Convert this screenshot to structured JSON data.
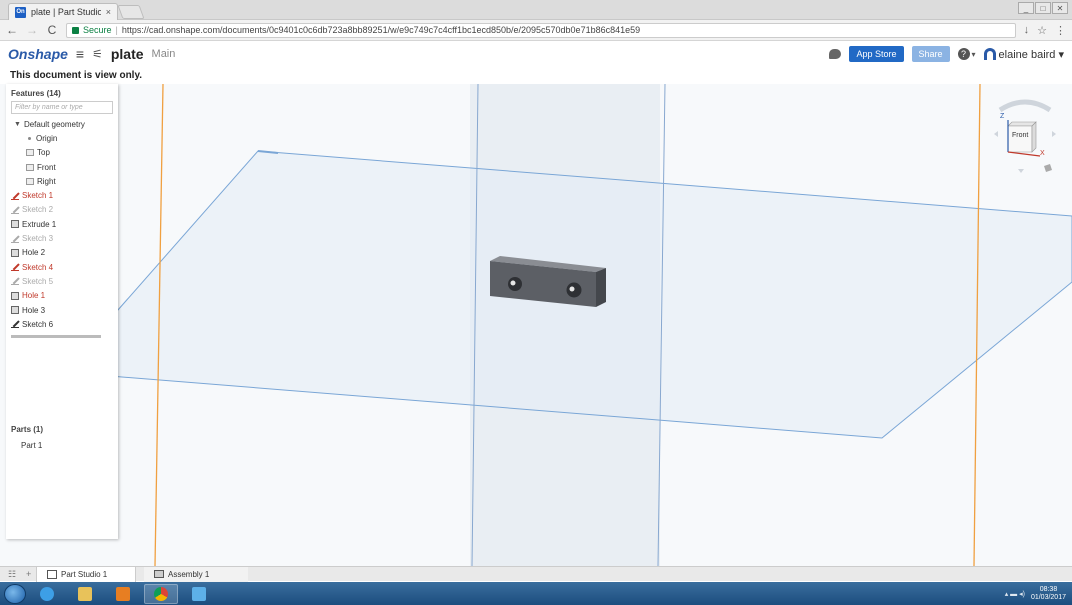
{
  "browser": {
    "tab_title": "plate | Part Studio 1",
    "tab_close": "×",
    "favicon_text": "On",
    "secure_label": "Secure",
    "url": "https://cad.onshape.com/documents/0c9401c0c6db723a8bb89251/w/e9c749c7c4cff1bc1ecd850b/e/2095c570db0e71b86c841e59",
    "back_icon": "←",
    "forward_icon": "→",
    "reload_icon": "C",
    "win_min": "_",
    "win_max": "□",
    "win_close": "✕",
    "ext_icon": "↓",
    "star_icon": "☆",
    "menu_icon": "⋮"
  },
  "app": {
    "logo": "Onshape",
    "menu_icon": "≡",
    "versions_icon": "⚟",
    "doc_name": "plate",
    "branch": "Main",
    "app_store_label": "App Store",
    "share_label": "Share",
    "help_label": "?",
    "help_caret": "▾",
    "user_name": "elaine baird ▾",
    "view_only_notice": "This document is view only."
  },
  "features": {
    "header": "Features (14)",
    "filter_placeholder": "Filter by name or type",
    "items": [
      {
        "label": "Default geometry",
        "kind": "group"
      },
      {
        "label": "Origin",
        "kind": "origin"
      },
      {
        "label": "Top",
        "kind": "plane"
      },
      {
        "label": "Front",
        "kind": "plane"
      },
      {
        "label": "Right",
        "kind": "plane"
      },
      {
        "label": "Sketch 1",
        "kind": "sketch-red"
      },
      {
        "label": "Sketch 2",
        "kind": "sketch-dim"
      },
      {
        "label": "Extrude 1",
        "kind": "feature"
      },
      {
        "label": "Sketch 3",
        "kind": "sketch-dim"
      },
      {
        "label": "Hole 2",
        "kind": "feature"
      },
      {
        "label": "Sketch 4",
        "kind": "sketch-red"
      },
      {
        "label": "Sketch 5",
        "kind": "sketch-dim"
      },
      {
        "label": "Hole 1",
        "kind": "feature-red"
      },
      {
        "label": "Hole 3",
        "kind": "feature"
      },
      {
        "label": "Sketch 6",
        "kind": "sketch"
      }
    ]
  },
  "parts": {
    "header": "Parts (1)",
    "items": [
      "Part 1"
    ]
  },
  "viewcube": {
    "face_label": "Front",
    "z_label": "Z",
    "x_label": "X"
  },
  "bottom_tabs": {
    "add_icon": "+",
    "tabs": [
      "Part Studio 1",
      "Assembly 1"
    ]
  },
  "taskbar": {
    "time": "08:38",
    "date": "01/03/2017",
    "tray_icons": "▴ ▬ ◂)"
  },
  "colors": {
    "brand": "#2a5aa8",
    "accent_button": "#2169c5",
    "plane_edge": "#7aa6d6",
    "axis_orange": "#f0a040",
    "sketch_red": "#c0392b"
  }
}
